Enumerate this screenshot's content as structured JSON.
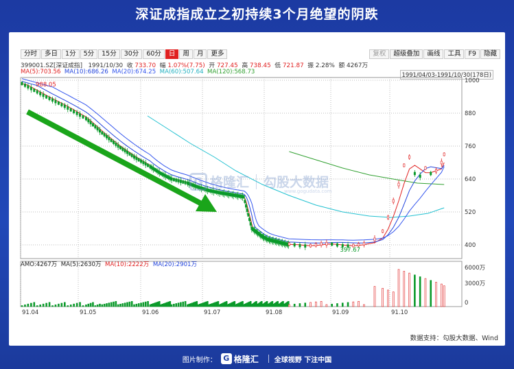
{
  "title": "深证成指成立之初持续3个月绝望的阴跌",
  "toolbar": {
    "buttons": [
      "分时",
      "多日",
      "1分",
      "5分",
      "15分",
      "30分",
      "60分",
      "日",
      "周",
      "月",
      "更多"
    ],
    "active_index": 7,
    "right_buttons": [
      "复权",
      "超级叠加",
      "画线",
      "工具",
      "F9",
      "隐藏"
    ]
  },
  "info": {
    "code": "399001.SZ[深证成指]",
    "date": "1991/10/30",
    "close_label": "收",
    "close": "733.70",
    "amp_label": "幅",
    "change": "1.07%(7.75)",
    "open_label": "开",
    "open": "727.45",
    "high_label": "高",
    "high": "738.45",
    "low_label": "低",
    "low": "721.87",
    "swing_label": "振",
    "swing": "2.28%",
    "amount_label": "额",
    "amount": "4267万"
  },
  "ma": {
    "ma5": "MA(5):703.56",
    "ma10": "MA(10):686.26",
    "ma20": "MA(20):674.25",
    "ma60": "MA(60):507.64",
    "ma120": "MA(120):568.73"
  },
  "range_label": "1991/04/03-1991/10/30(178日)",
  "amo": {
    "amo": "AMO:4267万",
    "ma5": "MA(5):2630万",
    "ma10": "MA(10):2222万",
    "ma20": "MA(20):2901万"
  },
  "watermark": {
    "logo": "G",
    "name": "格隆汇",
    "right": "勾股大数据",
    "url": "www.gogudata.com"
  },
  "source": "数据支持：勾股大数据、Wind",
  "footer": {
    "made_by": "图片制作：",
    "logo": "G",
    "brand": "格隆汇",
    "slogan": "全球视野 下注中国"
  },
  "colors": {
    "up": "#e02020",
    "down": "#0a9a2a",
    "ma5": "#e02020",
    "ma10": "#2244dd",
    "ma20": "#3355ee",
    "ma60": "#20c0d0",
    "ma120": "#30a030",
    "arrow": "#1aa51a"
  },
  "chart_data": {
    "type": "candlestick",
    "x_ticks": [
      "91.04",
      "91.05",
      "91.06",
      "91.07",
      "91.08",
      "91.09",
      "91.10"
    ],
    "y_ticks": [
      1000,
      880,
      760,
      640,
      520,
      400
    ],
    "ylim": [
      350,
      1010
    ],
    "annotations": {
      "high": "988.05",
      "low": "397.67"
    },
    "price_x": [
      0,
      0.08,
      0.16,
      0.24,
      0.3,
      0.36,
      0.42,
      0.48,
      0.52,
      0.56,
      0.62,
      0.66,
      0.7,
      0.74,
      0.77,
      0.8,
      0.83,
      0.86,
      0.88,
      0.9,
      0.92,
      0.94,
      0.96,
      0.98,
      1.0
    ],
    "price": [
      988,
      945,
      905,
      860,
      808,
      760,
      720,
      685,
      660,
      640,
      625,
      610,
      598,
      590,
      585,
      580,
      575,
      460,
      445,
      430,
      420,
      415,
      410,
      405,
      400
    ],
    "ma60_points": [
      [
        0.47,
        870
      ],
      [
        0.55,
        820
      ],
      [
        0.63,
        770
      ],
      [
        0.72,
        720
      ],
      [
        0.8,
        670
      ],
      [
        0.9,
        620
      ],
      [
        1.0,
        580
      ],
      [
        1.1,
        545
      ],
      [
        1.2,
        520
      ],
      [
        1.3,
        505
      ],
      [
        1.38,
        500
      ],
      [
        1.45,
        505
      ],
      [
        1.52,
        515
      ],
      [
        1.58,
        535
      ]
    ],
    "ma120_points": [
      [
        1.0,
        740
      ],
      [
        1.1,
        710
      ],
      [
        1.2,
        680
      ],
      [
        1.3,
        655
      ],
      [
        1.4,
        638
      ],
      [
        1.48,
        625
      ],
      [
        1.58,
        620
      ]
    ],
    "amo_ticks": [
      "6000万",
      "3000万",
      "0"
    ],
    "amo_max": 6000
  }
}
